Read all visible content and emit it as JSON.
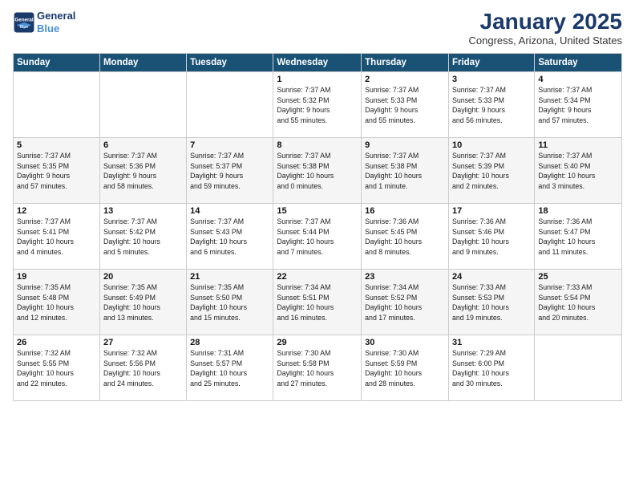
{
  "header": {
    "logo_line1": "General",
    "logo_line2": "Blue",
    "month": "January 2025",
    "location": "Congress, Arizona, United States"
  },
  "weekdays": [
    "Sunday",
    "Monday",
    "Tuesday",
    "Wednesday",
    "Thursday",
    "Friday",
    "Saturday"
  ],
  "weeks": [
    [
      {
        "day": "",
        "info": ""
      },
      {
        "day": "",
        "info": ""
      },
      {
        "day": "",
        "info": ""
      },
      {
        "day": "1",
        "info": "Sunrise: 7:37 AM\nSunset: 5:32 PM\nDaylight: 9 hours\nand 55 minutes."
      },
      {
        "day": "2",
        "info": "Sunrise: 7:37 AM\nSunset: 5:33 PM\nDaylight: 9 hours\nand 55 minutes."
      },
      {
        "day": "3",
        "info": "Sunrise: 7:37 AM\nSunset: 5:33 PM\nDaylight: 9 hours\nand 56 minutes."
      },
      {
        "day": "4",
        "info": "Sunrise: 7:37 AM\nSunset: 5:34 PM\nDaylight: 9 hours\nand 57 minutes."
      }
    ],
    [
      {
        "day": "5",
        "info": "Sunrise: 7:37 AM\nSunset: 5:35 PM\nDaylight: 9 hours\nand 57 minutes."
      },
      {
        "day": "6",
        "info": "Sunrise: 7:37 AM\nSunset: 5:36 PM\nDaylight: 9 hours\nand 58 minutes."
      },
      {
        "day": "7",
        "info": "Sunrise: 7:37 AM\nSunset: 5:37 PM\nDaylight: 9 hours\nand 59 minutes."
      },
      {
        "day": "8",
        "info": "Sunrise: 7:37 AM\nSunset: 5:38 PM\nDaylight: 10 hours\nand 0 minutes."
      },
      {
        "day": "9",
        "info": "Sunrise: 7:37 AM\nSunset: 5:38 PM\nDaylight: 10 hours\nand 1 minute."
      },
      {
        "day": "10",
        "info": "Sunrise: 7:37 AM\nSunset: 5:39 PM\nDaylight: 10 hours\nand 2 minutes."
      },
      {
        "day": "11",
        "info": "Sunrise: 7:37 AM\nSunset: 5:40 PM\nDaylight: 10 hours\nand 3 minutes."
      }
    ],
    [
      {
        "day": "12",
        "info": "Sunrise: 7:37 AM\nSunset: 5:41 PM\nDaylight: 10 hours\nand 4 minutes."
      },
      {
        "day": "13",
        "info": "Sunrise: 7:37 AM\nSunset: 5:42 PM\nDaylight: 10 hours\nand 5 minutes."
      },
      {
        "day": "14",
        "info": "Sunrise: 7:37 AM\nSunset: 5:43 PM\nDaylight: 10 hours\nand 6 minutes."
      },
      {
        "day": "15",
        "info": "Sunrise: 7:37 AM\nSunset: 5:44 PM\nDaylight: 10 hours\nand 7 minutes."
      },
      {
        "day": "16",
        "info": "Sunrise: 7:36 AM\nSunset: 5:45 PM\nDaylight: 10 hours\nand 8 minutes."
      },
      {
        "day": "17",
        "info": "Sunrise: 7:36 AM\nSunset: 5:46 PM\nDaylight: 10 hours\nand 9 minutes."
      },
      {
        "day": "18",
        "info": "Sunrise: 7:36 AM\nSunset: 5:47 PM\nDaylight: 10 hours\nand 11 minutes."
      }
    ],
    [
      {
        "day": "19",
        "info": "Sunrise: 7:35 AM\nSunset: 5:48 PM\nDaylight: 10 hours\nand 12 minutes."
      },
      {
        "day": "20",
        "info": "Sunrise: 7:35 AM\nSunset: 5:49 PM\nDaylight: 10 hours\nand 13 minutes."
      },
      {
        "day": "21",
        "info": "Sunrise: 7:35 AM\nSunset: 5:50 PM\nDaylight: 10 hours\nand 15 minutes."
      },
      {
        "day": "22",
        "info": "Sunrise: 7:34 AM\nSunset: 5:51 PM\nDaylight: 10 hours\nand 16 minutes."
      },
      {
        "day": "23",
        "info": "Sunrise: 7:34 AM\nSunset: 5:52 PM\nDaylight: 10 hours\nand 17 minutes."
      },
      {
        "day": "24",
        "info": "Sunrise: 7:33 AM\nSunset: 5:53 PM\nDaylight: 10 hours\nand 19 minutes."
      },
      {
        "day": "25",
        "info": "Sunrise: 7:33 AM\nSunset: 5:54 PM\nDaylight: 10 hours\nand 20 minutes."
      }
    ],
    [
      {
        "day": "26",
        "info": "Sunrise: 7:32 AM\nSunset: 5:55 PM\nDaylight: 10 hours\nand 22 minutes."
      },
      {
        "day": "27",
        "info": "Sunrise: 7:32 AM\nSunset: 5:56 PM\nDaylight: 10 hours\nand 24 minutes."
      },
      {
        "day": "28",
        "info": "Sunrise: 7:31 AM\nSunset: 5:57 PM\nDaylight: 10 hours\nand 25 minutes."
      },
      {
        "day": "29",
        "info": "Sunrise: 7:30 AM\nSunset: 5:58 PM\nDaylight: 10 hours\nand 27 minutes."
      },
      {
        "day": "30",
        "info": "Sunrise: 7:30 AM\nSunset: 5:59 PM\nDaylight: 10 hours\nand 28 minutes."
      },
      {
        "day": "31",
        "info": "Sunrise: 7:29 AM\nSunset: 6:00 PM\nDaylight: 10 hours\nand 30 minutes."
      },
      {
        "day": "",
        "info": ""
      }
    ]
  ]
}
